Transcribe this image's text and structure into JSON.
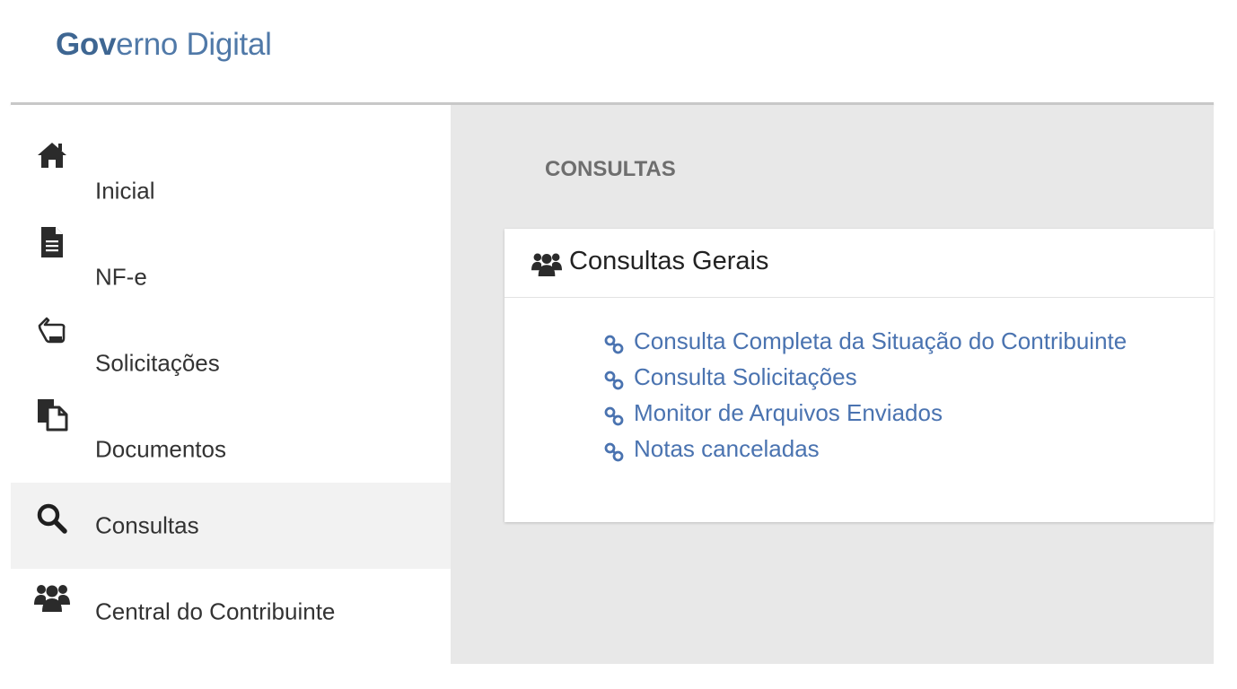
{
  "header": {
    "brand_bold": "Gov",
    "brand_rest": "erno Digital"
  },
  "sidebar": {
    "items": [
      {
        "label": "Inicial",
        "icon": "home-icon"
      },
      {
        "label": "NF-e",
        "icon": "document-icon"
      },
      {
        "label": "Solicitações",
        "icon": "hand-pointer-icon"
      },
      {
        "label": "Documentos",
        "icon": "copy-documents-icon"
      },
      {
        "label": "Consultas",
        "icon": "search-icon",
        "active": true
      },
      {
        "label": "Central do Contribuinte",
        "icon": "users-icon"
      }
    ]
  },
  "main": {
    "title": "CONSULTAS",
    "card": {
      "title": "Consultas Gerais",
      "icon": "users-icon",
      "links": [
        {
          "label": "Consulta Completa da Situação do Contribuinte",
          "icon": "link-icon"
        },
        {
          "label": "Consulta Solicitações",
          "icon": "link-icon"
        },
        {
          "label": "Monitor de Arquivos Enviados",
          "icon": "link-icon"
        },
        {
          "label": "Notas canceladas",
          "icon": "link-icon"
        }
      ]
    }
  },
  "colors": {
    "brand": "#5079a8",
    "link": "#4a73b0",
    "content_bg": "#e8e8e8",
    "active_bg": "#f2f2f2"
  }
}
